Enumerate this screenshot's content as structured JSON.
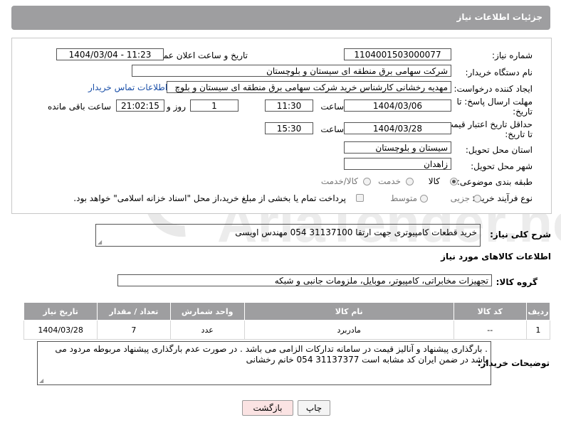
{
  "header": {
    "title": "جزئیات اطلاعات نیاز"
  },
  "fields": {
    "need_number_label": "شماره نیاز:",
    "need_number": "1104001503000077",
    "announce_label": "تاریخ و ساعت اعلان عمومی:",
    "announce_value": "1404/03/04 - 11:23",
    "buyer_org_label": "نام دستگاه خریدار:",
    "buyer_org": "شرکت سهامی برق منطقه ای سیستان و بلوچستان",
    "creator_label": "ایجاد کننده درخواست:",
    "creator": "مهدیه رخشانی کارشناس خرید شرکت سهامی برق منطقه ای سیستان و بلوچ",
    "contact_link": "اطلاعات تماس خریدار",
    "deadline_label_1": "مهلت ارسال پاسخ: تا",
    "deadline_label_2": "تاریخ:",
    "deadline_date": "1404/03/06",
    "time_label": "ساعت",
    "deadline_time": "11:30",
    "days_value": "1",
    "days_label": "روز و",
    "remaining_time": "21:02:15",
    "remaining_label": "ساعت باقی مانده",
    "min_price_label_1": "حداقل تاریخ اعتبار قیمت:",
    "min_price_label_2": "تا تاریخ:",
    "validity_date": "1404/03/28",
    "validity_time": "15:30",
    "delivery_province_label": "استان محل تحویل:",
    "delivery_province": "سیستان و بلوچستان",
    "delivery_city_label": "شهر محل تحویل:",
    "delivery_city": "زاهدان",
    "category_label": "طبقه بندی موضوعی:",
    "category_options": [
      "کالا",
      "خدمت",
      "کالا/خدمت"
    ],
    "process_label": "نوع فرآیند خرید :",
    "process_options": [
      "جزیی",
      "متوسط"
    ],
    "payment_note": "پرداخت تمام یا بخشی از مبلغ خرید،از محل \"اسناد خزانه اسلامی\" خواهد بود."
  },
  "description": {
    "label": "شرح کلی نیاز:",
    "text": "خرید قطعات کامپیوتری جهت ارتقا 31137100 054 مهندس اویسی"
  },
  "goods_section_title": "اطلاعات کالاهای مورد نیاز",
  "goods_group": {
    "label": "گروه کالا:",
    "value": "تجهیزات مخابراتی، کامپیوتر، موبایل، ملزومات جانبی و شبکه"
  },
  "table": {
    "headers": [
      "ردیف",
      "کد کالا",
      "نام کالا",
      "واحد شمارش",
      "تعداد / مقدار",
      "تاریخ نیاز"
    ],
    "rows": [
      [
        "1",
        "--",
        "مادربرد",
        "عدد",
        "7",
        "1404/03/28"
      ]
    ]
  },
  "buyer_notes": {
    "label": "توضیحات خریدار:",
    "text": ". بارگذاری پیشنهاد و آنالیز قیمت در سامانه تدارکات الزامی می باشد . در صورت عدم بارگذاری پیشنهاد مربوطه مردود می باشد در ضمن ایران کد مشابه است 31137377 054 خانم رخشانی"
  },
  "buttons": {
    "print": "چاپ",
    "back": "بازگشت"
  },
  "watermark": {
    "text": "AriaTender.neT"
  },
  "colors": {
    "header_bg": "#9e9ea0",
    "link": "#1a4fa8",
    "back_button_bg": "#fbe3e3",
    "watermark": "#e7e7e7"
  }
}
